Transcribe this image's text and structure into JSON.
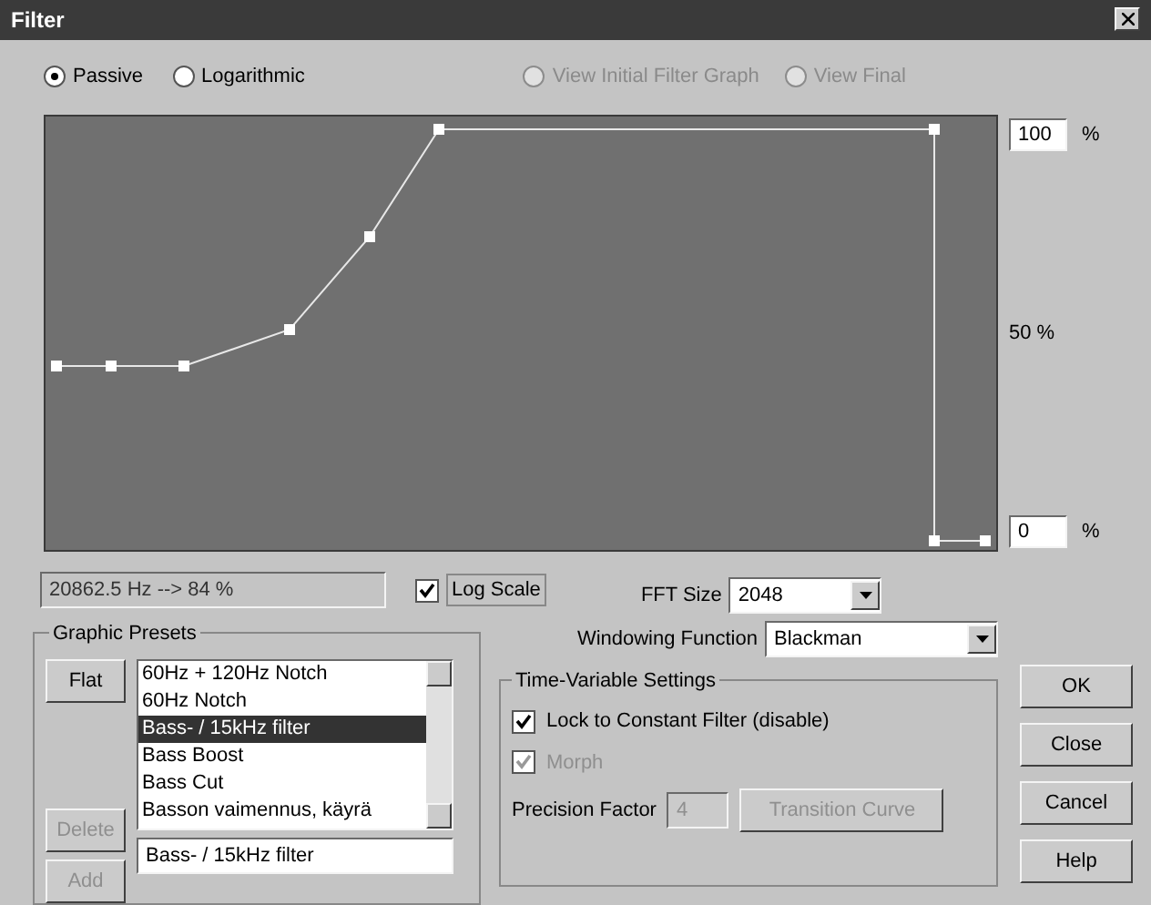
{
  "window": {
    "title": "Filter"
  },
  "mode_radios": [
    {
      "label": "Passive",
      "selected": true
    },
    {
      "label": "Logarithmic",
      "selected": false
    }
  ],
  "view_radios": [
    {
      "label": "View Initial Filter Graph",
      "selected": false,
      "disabled": true
    },
    {
      "label": "View Final",
      "selected": false,
      "disabled": true
    }
  ],
  "graph_scale": {
    "top_value": "100",
    "top_unit": "%",
    "middle": "50 %",
    "bottom_value": "0",
    "bottom_unit": "%"
  },
  "readout": "20862.5 Hz --> 84 %",
  "log_scale": {
    "label": "Log Scale",
    "checked": true
  },
  "fft_size": {
    "label": "FFT Size",
    "value": "2048"
  },
  "windowing_function": {
    "label": "Windowing Function",
    "value": "Blackman"
  },
  "graphic_presets": {
    "title": "Graphic Presets",
    "buttons": [
      {
        "label": "Flat",
        "disabled": false
      },
      {
        "label": "Delete",
        "disabled": true
      },
      {
        "label": "Add",
        "disabled": true
      }
    ],
    "items": [
      {
        "label": "60Hz + 120Hz Notch",
        "selected": false
      },
      {
        "label": "60Hz Notch",
        "selected": false
      },
      {
        "label": "Bass- / 15kHz filter",
        "selected": true
      },
      {
        "label": "Bass Boost",
        "selected": false
      },
      {
        "label": "Bass Cut",
        "selected": false
      },
      {
        "label": "Basson vaimennus, käyrä",
        "selected": false
      }
    ],
    "name_value": "Bass- / 15kHz filter"
  },
  "time_variable": {
    "title": "Time-Variable Settings",
    "checkboxes": [
      {
        "label": "Lock to Constant Filter (disable)",
        "checked": true,
        "disabled": false
      },
      {
        "label": "Morph",
        "checked": true,
        "disabled": true
      }
    ],
    "precision": {
      "label": "Precision Factor",
      "value": "4",
      "disabled": true
    },
    "transition": {
      "label": "Transition Curve",
      "disabled": true
    }
  },
  "buttons": [
    "OK",
    "Close",
    "Cancel",
    "Help"
  ]
}
